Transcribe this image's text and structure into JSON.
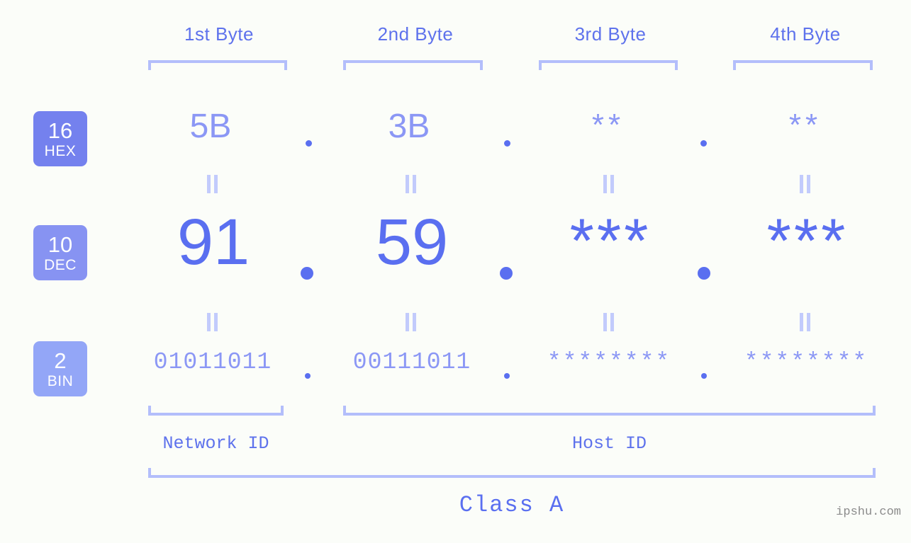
{
  "page": {
    "background_color": "#fbfdf9",
    "accent_strong": "#5a6ff0",
    "accent_medium": "#8b97f5",
    "accent_light": "#b3befb"
  },
  "header": {
    "byte_labels": [
      {
        "text": "1st Byte"
      },
      {
        "text": "2nd Byte"
      },
      {
        "text": "3rd Byte"
      },
      {
        "text": "4th Byte"
      }
    ]
  },
  "bases": [
    {
      "number": "16",
      "label": "HEX",
      "color": "#7481ee"
    },
    {
      "number": "10",
      "label": "DEC",
      "color": "#8793f2"
    },
    {
      "number": "2",
      "label": "BIN",
      "color": "#93a6f7"
    }
  ],
  "rows": {
    "hex": {
      "base_number": "16",
      "base_label": "HEX",
      "values": [
        "5B",
        "3B",
        "**",
        "**"
      ],
      "separator": "."
    },
    "dec": {
      "base_number": "10",
      "base_label": "DEC",
      "values": [
        "91",
        "59",
        "***",
        "***"
      ],
      "separator": "."
    },
    "bin": {
      "base_number": "2",
      "base_label": "BIN",
      "values": [
        "01011011",
        "00111011",
        "********",
        "********"
      ],
      "separator": "."
    }
  },
  "segments": {
    "network_id": "Network ID",
    "host_id": "Host ID",
    "class": "Class A"
  },
  "watermark": "ipshu.com"
}
